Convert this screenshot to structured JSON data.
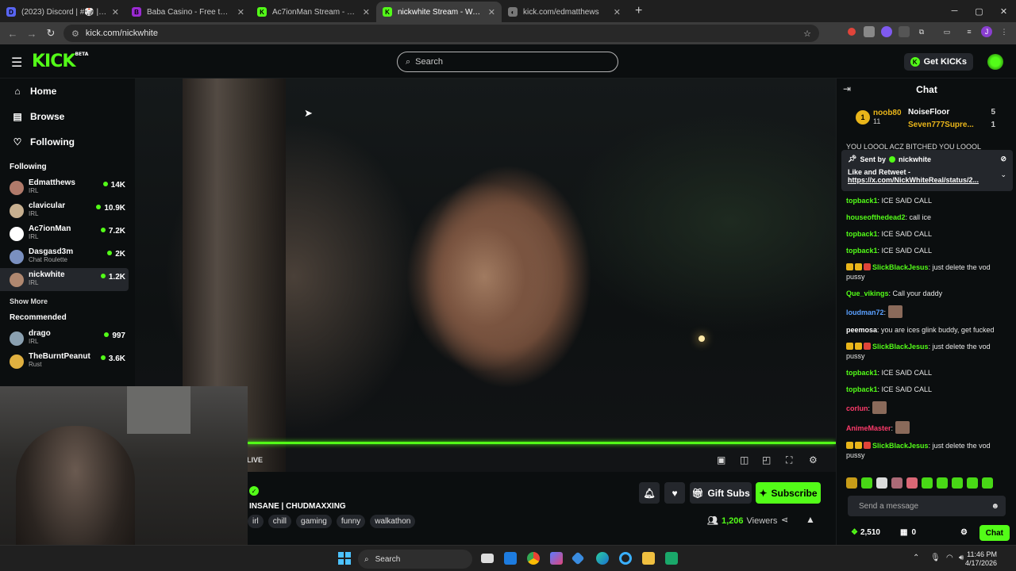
{
  "browser": {
    "tabs": [
      {
        "title": "(2023) Discord | #🎲 | Freebies",
        "fav_color": "#5865f2",
        "fav_text": "D"
      },
      {
        "title": "Baba Casino - Free to Play Slots",
        "fav_color": "#9b2ad3",
        "fav_text": "B"
      },
      {
        "title": "Ac7ionMan Stream - Watch Live",
        "fav_color": "#53fc18",
        "fav_text": "K"
      },
      {
        "title": "nickwhite Stream - Watch Live",
        "fav_color": "#53fc18",
        "fav_text": "K"
      },
      {
        "title": "kick.com/edmatthews",
        "fav_color": "#777777",
        "fav_text": "◐"
      }
    ],
    "url": "kick.com/nickwhite"
  },
  "header": {
    "logo": "KICK",
    "logo_sup": "BETA",
    "search_placeholder": "Search",
    "get_kicks": "Get KICKs"
  },
  "sidebar": {
    "nav": [
      {
        "label": "Home",
        "icon": "home-icon",
        "glyph": "⌂"
      },
      {
        "label": "Browse",
        "icon": "browse-icon",
        "glyph": "▤"
      },
      {
        "label": "Following",
        "icon": "heart-icon",
        "glyph": "♡"
      }
    ],
    "following_title": "Following",
    "following": [
      {
        "name": "Edmatthews",
        "category": "IRL",
        "viewers": "14K",
        "color": "#b07a6a"
      },
      {
        "name": "clavicular",
        "category": "IRL",
        "viewers": "10.9K",
        "color": "#c8b090"
      },
      {
        "name": "Ac7ionMan",
        "category": "IRL",
        "viewers": "7.2K",
        "color": "#ffffff"
      },
      {
        "name": "Dasgasd3m",
        "category": "Chat Roulette",
        "viewers": "2K",
        "color": "#7a90c0"
      },
      {
        "name": "nickwhite",
        "category": "IRL",
        "viewers": "1.2K",
        "color": "#b08870"
      }
    ],
    "show_more": "Show More",
    "recommended_title": "Recommended",
    "recommended": [
      {
        "name": "drago",
        "category": "IRL",
        "viewers": "997",
        "color": "#8aa0b0"
      },
      {
        "name": "TheBurntPeanut",
        "category": "Rust",
        "viewers": "3.6K",
        "color": "#e0b040"
      }
    ]
  },
  "player": {
    "live_label": "LIVE"
  },
  "stream": {
    "title": "INSANE | CHUDMAXXING",
    "tags": [
      "irl",
      "chill",
      "gaming",
      "funny",
      "walkathon"
    ],
    "gift_subs": "Gift Subs",
    "subscribe": "Subscribe",
    "viewers_count": "1,206",
    "viewers_label": "Viewers"
  },
  "chat": {
    "title": "Chat",
    "leaderboard": [
      {
        "name": "noob80",
        "score": "11"
      },
      {
        "name": "NoiseFloor",
        "score": "5"
      },
      {
        "name": "Seven777Supre...",
        "score": "1"
      }
    ],
    "pinned": {
      "top_text": "YOU LOOOL ACZ BITCHED YOU LOOOL",
      "sent_by_label": "Sent by",
      "sender": "nickwhite",
      "message": "Like and Retweet -",
      "link": "https://x.com/NickWhiteReal/status/2..."
    },
    "messages": [
      {
        "user": "topback1",
        "color": "#53fc18",
        "text": "ICE SAID CALL",
        "badges": []
      },
      {
        "user": "houseofthedead2",
        "color": "#53fc18",
        "text": "call ice",
        "badges": []
      },
      {
        "user": "topback1",
        "color": "#53fc18",
        "text": "ICE SAID CALL",
        "badges": []
      },
      {
        "user": "topback1",
        "color": "#53fc18",
        "text": "ICE SAID CALL",
        "badges": []
      },
      {
        "user": "SlickBlackJesus",
        "color": "#53fc18",
        "text": "just delete the vod pussy",
        "badges": [
          "#e9b51a",
          "#e9b51a",
          "#e0443a"
        ]
      },
      {
        "user": "Que_vikings",
        "color": "#53fc18",
        "text": "Call your daddy",
        "badges": []
      },
      {
        "user": "loudman72",
        "color": "#5aa0ff",
        "text": "",
        "badges": []
      },
      {
        "user": "peemosa",
        "color": "#ffffff",
        "text": "you are ices glink buddy, get fucked",
        "badges": []
      },
      {
        "user": "SlickBlackJesus",
        "color": "#53fc18",
        "text": "just delete the vod pussy",
        "badges": [
          "#e9b51a",
          "#e9b51a",
          "#e0443a"
        ]
      },
      {
        "user": "topback1",
        "color": "#53fc18",
        "text": "ICE SAID CALL",
        "badges": []
      },
      {
        "user": "topback1",
        "color": "#53fc18",
        "text": "ICE SAID CALL",
        "badges": []
      },
      {
        "user": "corlun",
        "color": "#ff3b6b",
        "text": "",
        "badges": []
      },
      {
        "user": "AnimeMaster",
        "color": "#ff3b6b",
        "text": "",
        "badges": []
      },
      {
        "user": "SlickBlackJesus",
        "color": "#53fc18",
        "text": "just delete the vod pussy",
        "badges": [
          "#e9b51a",
          "#e9b51a",
          "#e0443a"
        ]
      }
    ],
    "input_placeholder": "Send a message",
    "kicks_balance": "2,510",
    "sub_count": "0",
    "chat_button": "Chat"
  },
  "taskbar": {
    "search": "Search",
    "time": "11:46 PM",
    "date": "4/17/2026"
  },
  "colors": {
    "accent": "#53fc18",
    "bg": "#0b0e0f",
    "panel": "#24272c"
  }
}
